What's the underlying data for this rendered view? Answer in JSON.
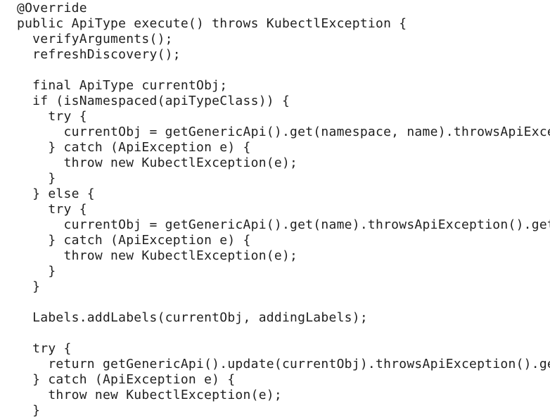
{
  "editor": {
    "lines": [
      "@Override",
      "public ApiType execute() throws KubectlException {",
      "  verifyArguments();",
      "  refreshDiscovery();",
      "",
      "  final ApiType currentObj;",
      "  if (isNamespaced(apiTypeClass)) {",
      "    try {",
      "      currentObj = getGenericApi().get(namespace, name).throwsApiExce",
      "    } catch (ApiException e) {",
      "      throw new KubectlException(e);",
      "    }",
      "  } else {",
      "    try {",
      "      currentObj = getGenericApi().get(name).throwsApiException().get",
      "    } catch (ApiException e) {",
      "      throw new KubectlException(e);",
      "    }",
      "  }",
      "",
      "  Labels.addLabels(currentObj, addingLabels);",
      "",
      "  try {",
      "    return getGenericApi().update(currentObj).throwsApiException().ge",
      "  } catch (ApiException e) {",
      "    throw new KubectlException(e);",
      "  }"
    ]
  }
}
